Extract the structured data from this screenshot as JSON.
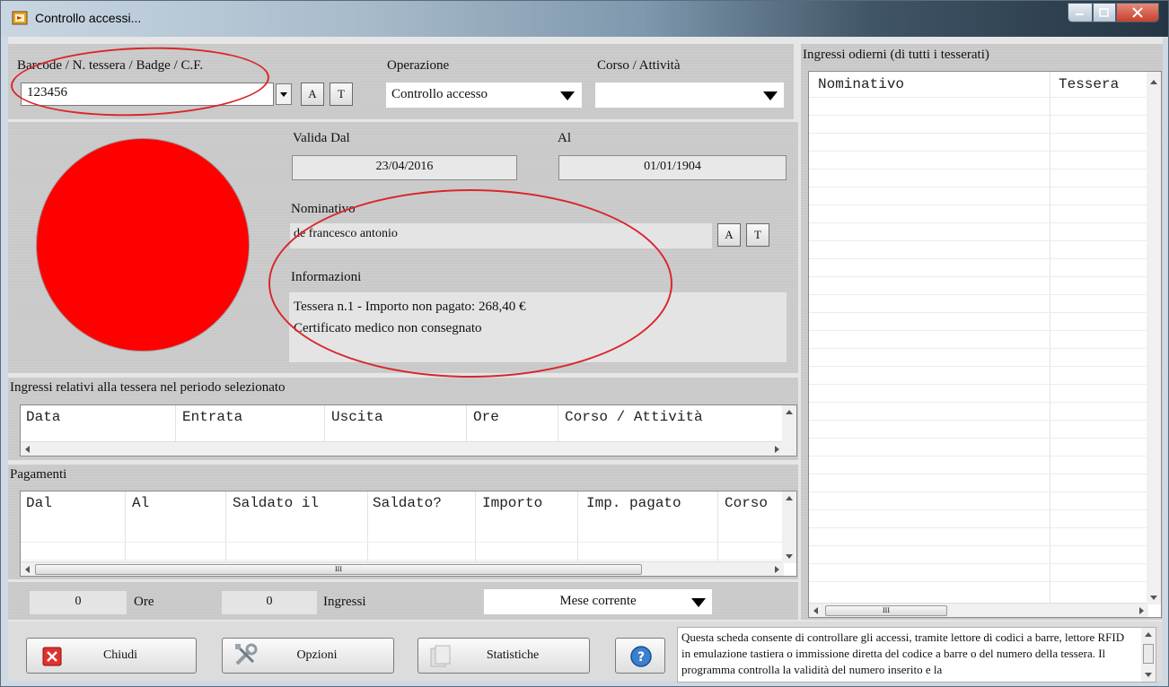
{
  "window": {
    "title": "Controllo accessi..."
  },
  "search": {
    "label": "Barcode / N. tessera / Badge / C.F.",
    "value": "123456",
    "btn_a": "A",
    "btn_t": "T"
  },
  "operation": {
    "label": "Operazione",
    "value": "Controllo accesso"
  },
  "course": {
    "label": "Corso / Attività",
    "value": ""
  },
  "validity": {
    "from_label": "Valida Dal",
    "from_value": "23/04/2016",
    "to_label": "Al",
    "to_value": "01/01/1904"
  },
  "member": {
    "name_label": "Nominativo",
    "name_value": "de francesco antonio",
    "btn_a": "A",
    "btn_t": "T",
    "info_label": "Informazioni",
    "info_line1": "Tessera n.1 - Importo non pagato: 268,40 €",
    "info_line2": "Certificato medico non consegnato"
  },
  "status": {
    "color": "#ff0000"
  },
  "entries": {
    "title": "Ingressi relativi alla tessera nel periodo selezionato",
    "columns": [
      "Data",
      "Entrata",
      "Uscita",
      "Ore",
      "Corso / Attività"
    ]
  },
  "payments": {
    "title": "Pagamenti",
    "columns": [
      "Dal",
      "Al",
      "Saldato il",
      "Saldato?",
      "Importo",
      "Imp. pagato",
      "Corso"
    ],
    "scroll_grip": "III"
  },
  "totals": {
    "hours_value": "0",
    "hours_label": "Ore",
    "entries_value": "0",
    "entries_label": "Ingressi",
    "period": "Mese corrente"
  },
  "today": {
    "title": "Ingressi odierni (di tutti i tesserati)",
    "columns": [
      "Nominativo",
      "Tessera"
    ],
    "scroll_grip": "III"
  },
  "buttons": {
    "close": "Chiudi",
    "options": "Opzioni",
    "stats": "Statistiche"
  },
  "help": {
    "text": "Questa scheda consente di controllare gli accessi, tramite lettore di codici a barre, lettore RFID in emulazione tastiera o immissione diretta del codice a barre o del numero della tessera. Il programma controlla la validità del numero inserito e la"
  }
}
